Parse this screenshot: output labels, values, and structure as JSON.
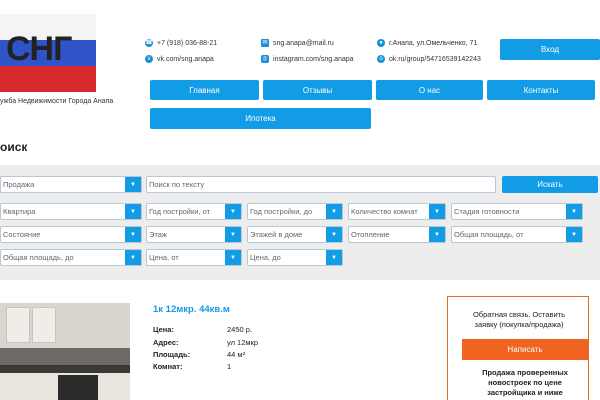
{
  "logo": {
    "text": "СНГ",
    "tagline": "ужба Недвижимости Города Анапа"
  },
  "contacts": {
    "phone": "+7 (918) 036-88-21",
    "vk": "vk.com/sng.anapa",
    "email": "sng.anapa@mail.ru",
    "instagram": "instagram.com/sng.anapa",
    "address": "г.Анапа, ул.Омельченко, 71",
    "ok": "ok.ru/group/54716539142243"
  },
  "header": {
    "login_label": "Вход"
  },
  "nav": {
    "items": [
      {
        "label": "Главная"
      },
      {
        "label": "Отзывы"
      },
      {
        "label": "О нас"
      },
      {
        "label": "Контакты"
      },
      {
        "label": "Ипотека"
      }
    ]
  },
  "search": {
    "title": "оиск",
    "deal_type": "Продажа",
    "text_placeholder": "Поиск по тексту",
    "button_label": "Искать",
    "filters": [
      "Квартира",
      "Год постройки, от",
      "Год постройки, до",
      "Количество комнат",
      "Стадия готовности",
      "Состояние",
      "Этаж",
      "Этажей в доме",
      "Отопление",
      "Общая площадь, от",
      "Общая площадь, до",
      "Цена, от",
      "Цена, до"
    ]
  },
  "listing": {
    "title": "1к 12мкр. 44кв.м",
    "fields": [
      {
        "label": "Цена:",
        "value": "2450 р."
      },
      {
        "label": "Адрес:",
        "value": "ул 12мкр"
      },
      {
        "label": "Площадь:",
        "value": "44 м²"
      },
      {
        "label": "Комнат:",
        "value": "1"
      }
    ]
  },
  "feedback": {
    "title": "Обратная связь. Оставить заявку (покупка/продажа)",
    "button_label": "Написать",
    "text": "Продажа проверенных новостроек по цене застройщика и ниже"
  },
  "colors": {
    "accent": "#129ce6",
    "orange": "#f06320",
    "panel": "#ededed"
  }
}
